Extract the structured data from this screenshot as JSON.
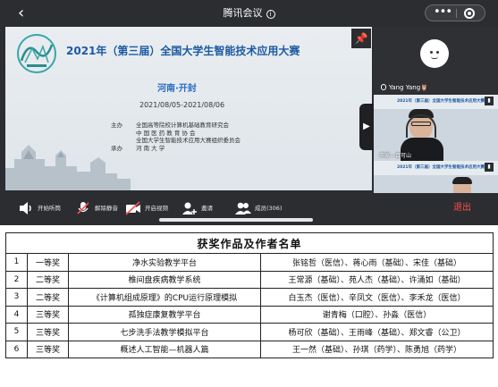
{
  "meeting": {
    "title": "腾讯会议",
    "info_glyph": "i",
    "back_glyph": "‹",
    "more_glyph": "•••"
  },
  "slide": {
    "title": "2021年（第三届）全国大学生智能技术应用大赛",
    "location": "河南·开封",
    "dates": "2021/08/05-2021/08/06",
    "organizers": [
      {
        "role": "主办",
        "name": "全国高等院校计算机基础教育研究会"
      },
      {
        "role": "",
        "name": "中  国  医  药  教  育  协  会"
      },
      {
        "role": "",
        "name": "全国大学生智能技术应用大赛组织委员会"
      },
      {
        "role": "承办",
        "name": "河        南        大        学"
      }
    ]
  },
  "participants": [
    {
      "name": "Yang Yang",
      "name_suffix": "🦉"
    },
    {
      "name": "李家—袁可山",
      "mini_title": "2021年（第三届）全国大学生智能技术应用大赛"
    },
    {
      "name": "",
      "mini_title": "2021年（第三届）全国大学生智能技术应用大赛"
    }
  ],
  "controls": {
    "audio": "开始听筒",
    "mute": "解除静音",
    "video": "开启视频",
    "invite": "邀请",
    "members": "成员(306)",
    "leave": "退出"
  },
  "table": {
    "caption": "获奖作品及作者名单",
    "rows": [
      {
        "no": "1",
        "award": "一等奖",
        "work": "净水实验教学平台",
        "authors": "张铭哲（医信）、蒋心雨（基础）、宋佳（基础）"
      },
      {
        "no": "2",
        "award": "二等奖",
        "work": "椎间盘疾病教学系统",
        "authors": "王常源（基础）、苑人杰（基础）、许涌如（基础）"
      },
      {
        "no": "3",
        "award": "二等奖",
        "work": "《计算机组成原理》的CPU运行原理模拟",
        "authors": "白玉杰（医信）、辛凤文（医信）、李禾龙（医信）"
      },
      {
        "no": "4",
        "award": "三等奖",
        "work": "孤独症康复教学平台",
        "authors": "谢青梅（口腔）、孙淼（医信）"
      },
      {
        "no": "5",
        "award": "三等奖",
        "work": "七步洗手法教学模拟平台",
        "authors": "杨可欣（基础）、王雨峰（基础）、郑文睿（公卫）"
      },
      {
        "no": "6",
        "award": "三等奖",
        "work": "概述人工智能—机器人篇",
        "authors": "王一然（基础）、孙琪（药学）、陈勇旭（药学）"
      }
    ]
  },
  "colors": {
    "meeting_bg": "#2b2d31",
    "leave": "#ff4d4f",
    "slide_title": "#1c5aa3"
  },
  "icons": [
    "back-icon",
    "info-icon",
    "more-icon",
    "record-icon",
    "pin-icon",
    "collapse-arrow-icon",
    "speaker-icon",
    "mic-muted-icon",
    "camera-off-icon",
    "invite-icon",
    "members-icon"
  ]
}
